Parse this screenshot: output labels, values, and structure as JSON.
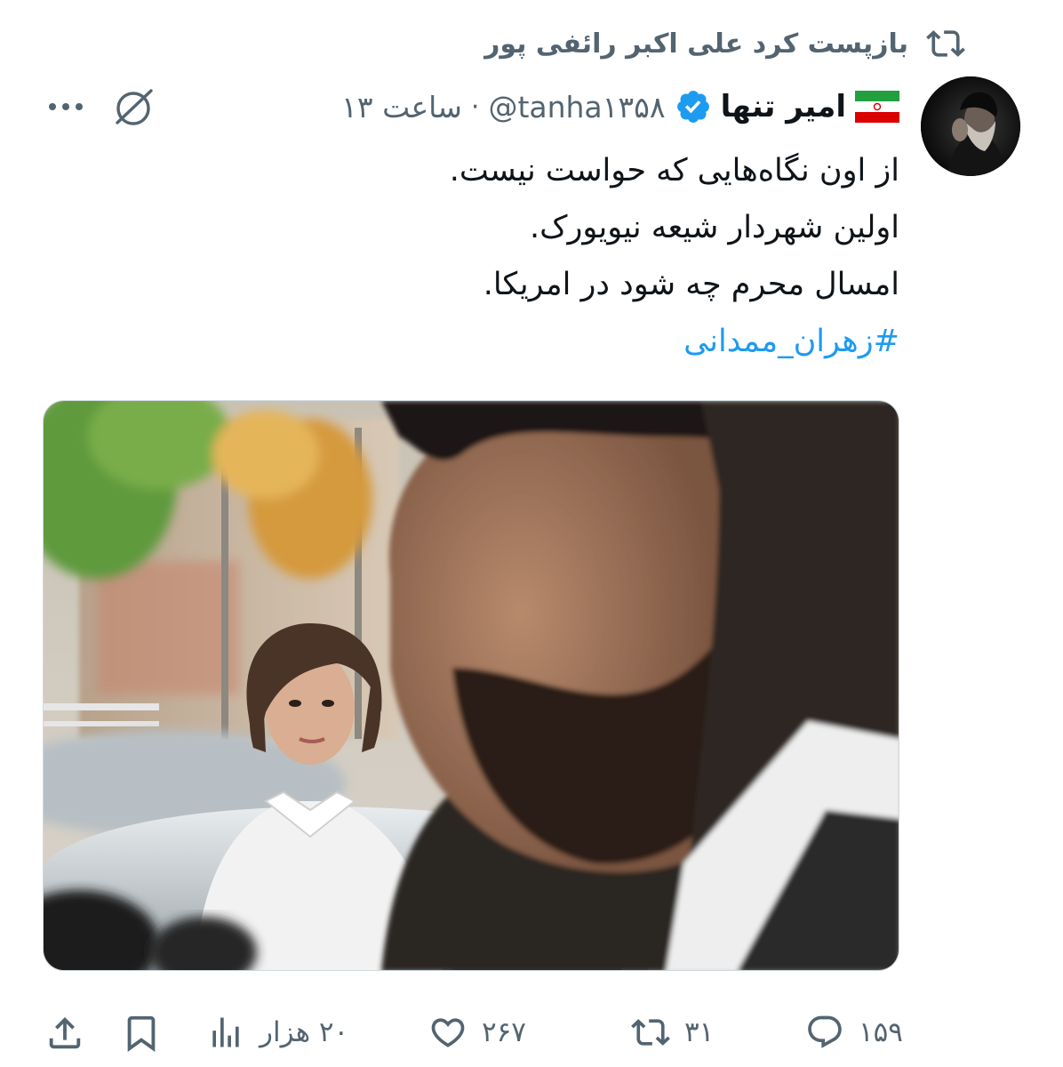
{
  "retweet": {
    "text": "بازپست کرد علی اکبر رائفی پور",
    "icon": "retweet-icon"
  },
  "author": {
    "name": "امیر تنها",
    "handle": "@tanha۱۳۵۸",
    "separator": "·",
    "time": "ساعت ۱۳",
    "verified": true,
    "flag_icon": "iran-flag-icon"
  },
  "tweet": {
    "lines": [
      "از اون نگاه‌هایی که حواست نیست.",
      "اولین شهردار شیعه نیویورک.",
      "امسال محرم چه شود در امریکا."
    ],
    "hashtag": "#زهران_ممدانی"
  },
  "actions": {
    "replies": "۱۵۹",
    "retweets": "۳۱",
    "likes": "۲۶۷",
    "views": "۲۰ هزار"
  },
  "colors": {
    "accent": "#1d9bf0",
    "secondary_text": "#536471",
    "primary_text": "#0f1419"
  }
}
